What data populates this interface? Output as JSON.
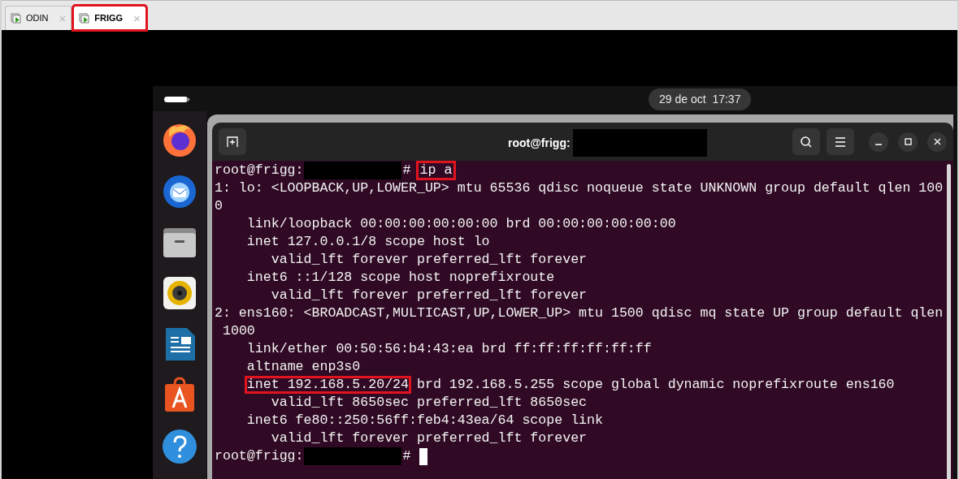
{
  "tabs": [
    {
      "label": "ODIN",
      "selected": false,
      "highlighted": false,
      "close": "×"
    },
    {
      "label": "FRIGG",
      "selected": true,
      "highlighted": true,
      "close": "×"
    }
  ],
  "top_bar": {
    "clock": "29 de oct  17:37"
  },
  "dock": [
    {
      "kind": "browser"
    },
    {
      "kind": "mail"
    },
    {
      "kind": "files"
    },
    {
      "kind": "music"
    },
    {
      "kind": "writer"
    },
    {
      "kind": "store"
    },
    {
      "kind": "help"
    }
  ],
  "terminal": {
    "title": "root@frigg:",
    "lines": [
      {
        "kind": "prompt",
        "user": "root@frigg:",
        "symbol": "#",
        "command": {
          "text": "ip a",
          "highlighted": true
        }
      },
      {
        "kind": "output",
        "segments": [
          {
            "text": "1: lo: <LOOPBACK,UP,LOWER_UP> mtu 65536 qdisc noqueue state UNKNOWN group default qlen 100",
            "highlighted": false
          }
        ]
      },
      {
        "kind": "output",
        "segments": [
          {
            "text": "0",
            "highlighted": false
          }
        ]
      },
      {
        "kind": "output",
        "segments": [
          {
            "text": "    link/loopback 00:00:00:00:00:00 brd 00:00:00:00:00:00",
            "highlighted": false
          }
        ]
      },
      {
        "kind": "output",
        "segments": [
          {
            "text": "    inet 127.0.0.1/8 scope host lo",
            "highlighted": false
          }
        ]
      },
      {
        "kind": "output",
        "segments": [
          {
            "text": "       valid_lft forever preferred_lft forever",
            "highlighted": false
          }
        ]
      },
      {
        "kind": "output",
        "segments": [
          {
            "text": "    inet6 ::1/128 scope host noprefixroute",
            "highlighted": false
          }
        ]
      },
      {
        "kind": "output",
        "segments": [
          {
            "text": "       valid_lft forever preferred_lft forever",
            "highlighted": false
          }
        ]
      },
      {
        "kind": "output",
        "segments": [
          {
            "text": "2: ens160: <BROADCAST,MULTICAST,UP,LOWER_UP> mtu 1500 qdisc mq state UP group default qlen",
            "highlighted": false
          }
        ]
      },
      {
        "kind": "output",
        "segments": [
          {
            "text": " 1000",
            "highlighted": false
          }
        ]
      },
      {
        "kind": "output",
        "segments": [
          {
            "text": "    link/ether 00:50:56:b4:43:ea brd ff:ff:ff:ff:ff:ff",
            "highlighted": false
          }
        ]
      },
      {
        "kind": "output",
        "segments": [
          {
            "text": "    altname enp3s0",
            "highlighted": false
          }
        ]
      },
      {
        "kind": "output",
        "segments": [
          {
            "text": "    inet 192.168.5.20/24",
            "highlighted": true
          },
          {
            "text": " brd 192.168.5.255 scope global dynamic noprefixroute ens160",
            "highlighted": false
          }
        ]
      },
      {
        "kind": "output",
        "segments": [
          {
            "text": "       valid_lft 8650sec preferred_lft 8650sec",
            "highlighted": false
          }
        ]
      },
      {
        "kind": "output",
        "segments": [
          {
            "text": "    inet6 fe80::250:56ff:feb4:43ea/64 scope link",
            "highlighted": false
          }
        ]
      },
      {
        "kind": "output",
        "segments": [
          {
            "text": "       valid_lft forever preferred_lft forever",
            "highlighted": false
          }
        ]
      },
      {
        "kind": "input",
        "user": "root@frigg:",
        "symbol": "#"
      }
    ]
  }
}
